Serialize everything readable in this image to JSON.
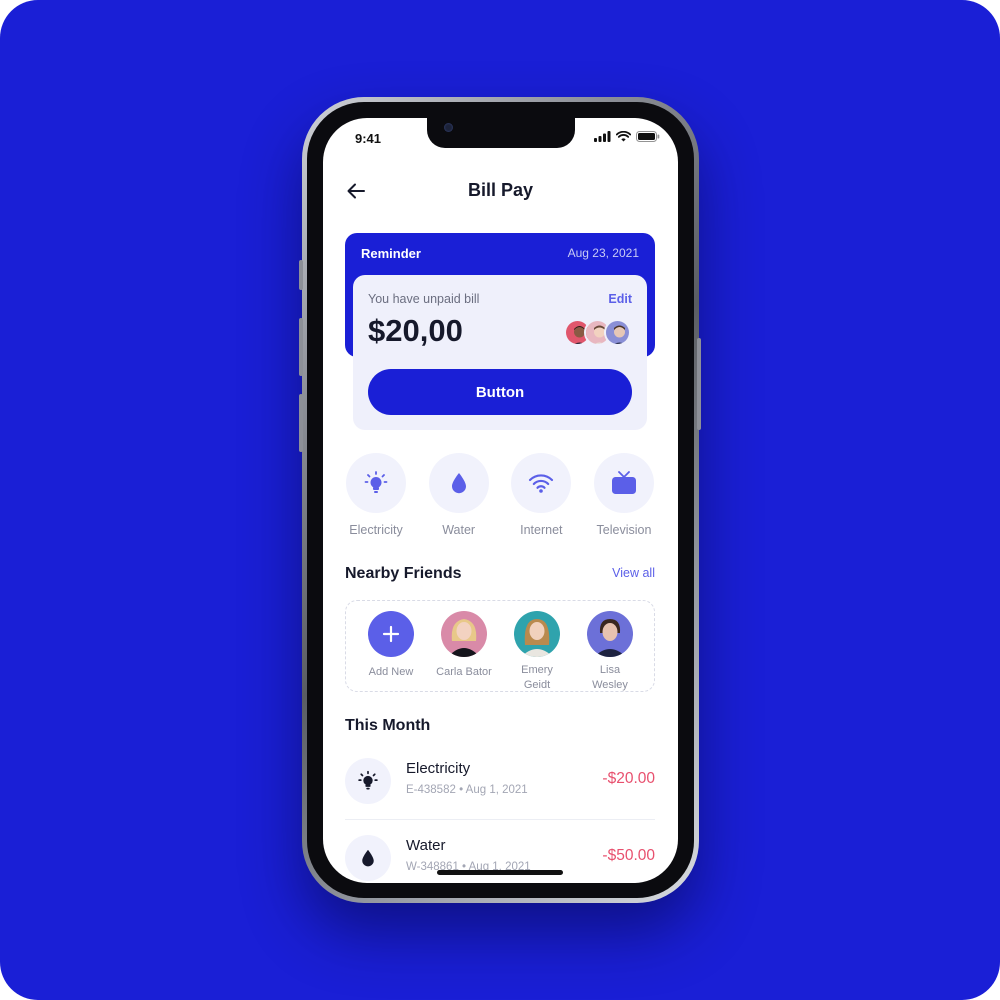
{
  "status_bar": {
    "time": "9:41"
  },
  "header": {
    "title": "Bill Pay"
  },
  "reminder": {
    "title": "Reminder",
    "date": "Aug 23, 2021",
    "label": "You have unpaid bill",
    "edit": "Edit",
    "amount": "$20,00",
    "button": "Button"
  },
  "categories": [
    {
      "label": "Electricity",
      "icon": "lightbulb-icon"
    },
    {
      "label": "Water",
      "icon": "water-drop-icon"
    },
    {
      "label": "Internet",
      "icon": "wifi-icon"
    },
    {
      "label": "Television",
      "icon": "tv-icon"
    }
  ],
  "nearby": {
    "title": "Nearby Friends",
    "view_all": "View all",
    "add_label": "Add New",
    "friends": [
      {
        "name": "Carla Bator"
      },
      {
        "name": "Emery Geidt"
      },
      {
        "name": "Lisa Wesley"
      }
    ]
  },
  "this_month": {
    "title": "This Month",
    "transactions": [
      {
        "name": "Electricity",
        "meta": "E-438582  •  Aug 1, 2021",
        "amount": "-$20.00",
        "icon": "lightbulb-icon"
      },
      {
        "name": "Water",
        "meta": "W-348861  •  Aug 1, 2021",
        "amount": "-$50.00",
        "icon": "water-drop-icon"
      }
    ]
  },
  "colors": {
    "background": "#1a1fd6",
    "accent": "#5b5fe8",
    "negative": "#e8506e",
    "card": "#eff0fb"
  }
}
